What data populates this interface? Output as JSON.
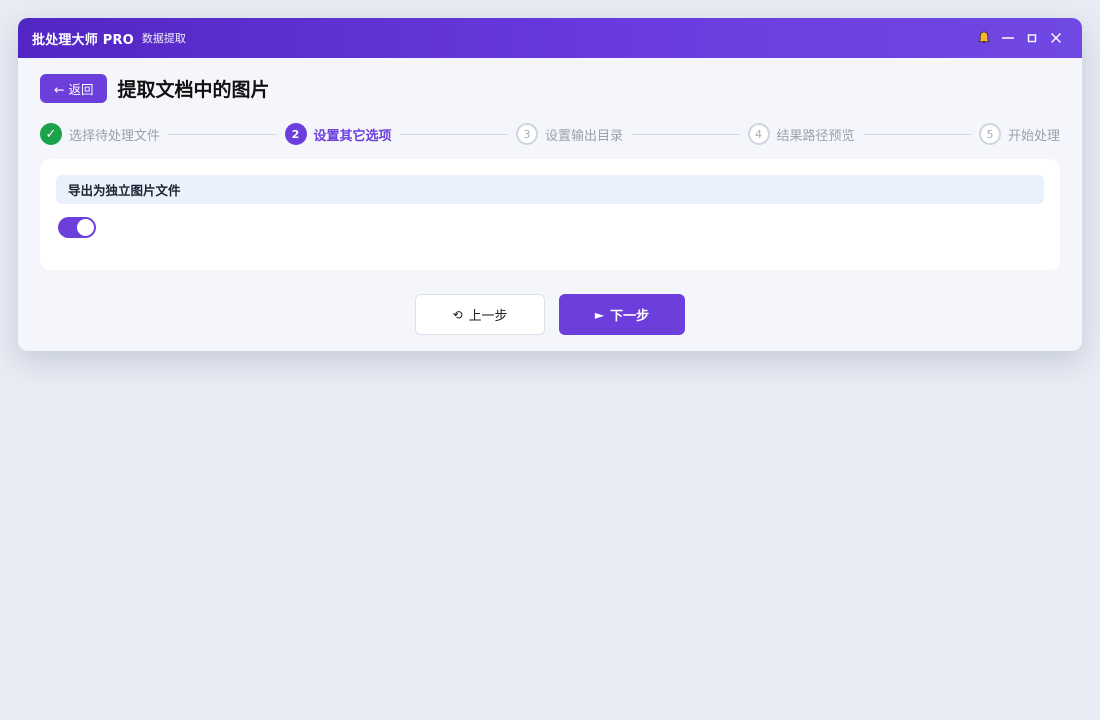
{
  "app": {
    "title": "批处理大师 PRO",
    "subtitle": "数据提取"
  },
  "window_controls": {
    "notifications_icon": "bell-icon",
    "minimize_icon": "minimize-icon",
    "maximize_icon": "maximize-icon",
    "close_icon": "close-icon"
  },
  "header": {
    "back_label": "← 返回",
    "page_title": "提取文档中的图片"
  },
  "steps": [
    {
      "number": "✓",
      "label": "选择待处理文件",
      "state": "done"
    },
    {
      "number": "2",
      "label": "设置其它选项",
      "state": "active"
    },
    {
      "number": "3",
      "label": "设置输出目录",
      "state": "pending"
    },
    {
      "number": "4",
      "label": "结果路径预览",
      "state": "pending"
    },
    {
      "number": "5",
      "label": "开始处理",
      "state": "pending"
    }
  ],
  "option": {
    "label": "导出为独立图片文件",
    "enabled": true
  },
  "footer": {
    "prev_icon": "⟲",
    "prev_label": "上一步",
    "next_icon": "►",
    "next_label": "下一步"
  },
  "colors": {
    "accent": "#6c3fdc",
    "done": "#1aa34a",
    "titlebar_start": "#5226c4",
    "titlebar_end": "#7048e2"
  }
}
